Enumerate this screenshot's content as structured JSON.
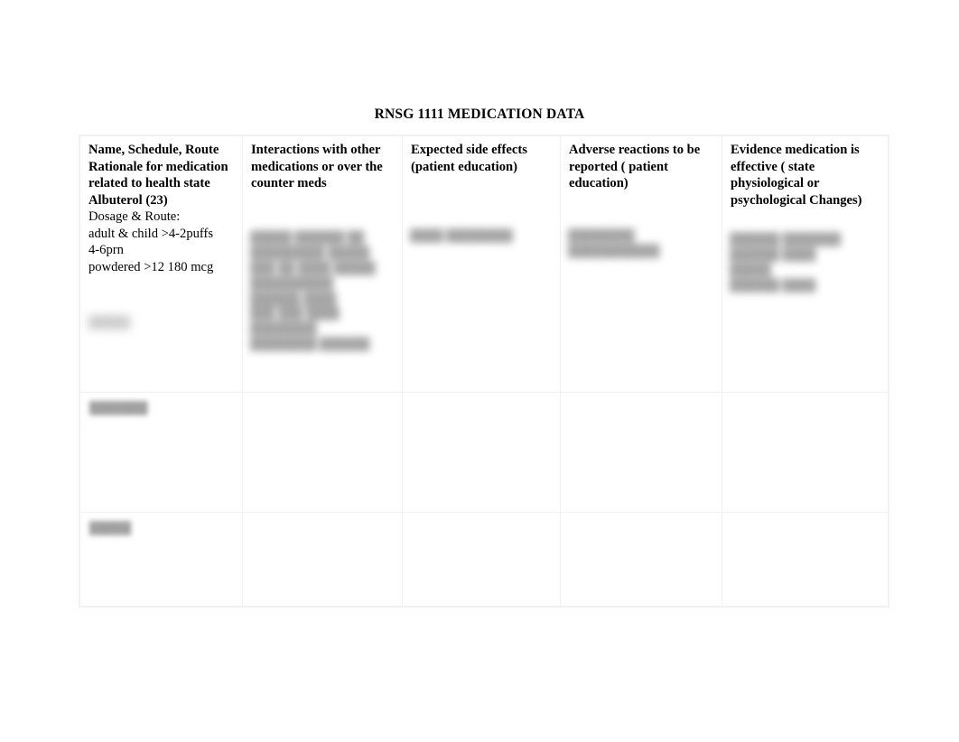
{
  "document": {
    "title": "RNSG 1111 MEDICATION DATA"
  },
  "table": {
    "columns": [
      {
        "id": "name-schedule-route",
        "header": "Name, Schedule, Route Rationale for medication related to health state"
      },
      {
        "id": "interactions",
        "header": "Interactions with other medications or over the counter meds"
      },
      {
        "id": "expected-side-effects",
        "header": "Expected side effects (patient education)"
      },
      {
        "id": "adverse-reactions",
        "header": "Adverse reactions to be reported ( patient education)"
      },
      {
        "id": "evidence-effective",
        "header": "Evidence medication is effective ( state physiological or psychological Changes)"
      }
    ],
    "rows": [
      {
        "id": "row-albuterol",
        "medication_name": "Albuterol (23)",
        "dosage_label": "Dosage & Route:",
        "dosage_lines": [
          "adult & child >4-2puffs",
          "4-6prn",
          "powdered >12 180 mcg"
        ],
        "redacted_cells": {
          "name_tail": "█████",
          "interactions": "█████ ██████ ██\n█████████ █████\n███ ██ ████ █████\n██████████\n██████ ████\n███ ███ ████\n████████\n████████ ██████",
          "expected_side_effects": "████ ████████",
          "adverse_reactions": "████████\n███████████",
          "evidence_effective": "██████ ███████\n██████ ████\n█████\n██████ ████"
        }
      },
      {
        "id": "row-2",
        "medication_name_redacted": "███████",
        "redacted_cells": {
          "interactions": "",
          "expected_side_effects": "",
          "adverse_reactions": "",
          "evidence_effective": ""
        }
      },
      {
        "id": "row-3",
        "medication_name_redacted": "█████",
        "redacted_cells": {
          "interactions": "",
          "expected_side_effects": "",
          "adverse_reactions": "",
          "evidence_effective": ""
        }
      }
    ]
  },
  "colors": {
    "page_background": "#ffffff",
    "text": "#000000",
    "table_border": "#f0f0f0",
    "redacted_text": "#8e8e8e"
  }
}
